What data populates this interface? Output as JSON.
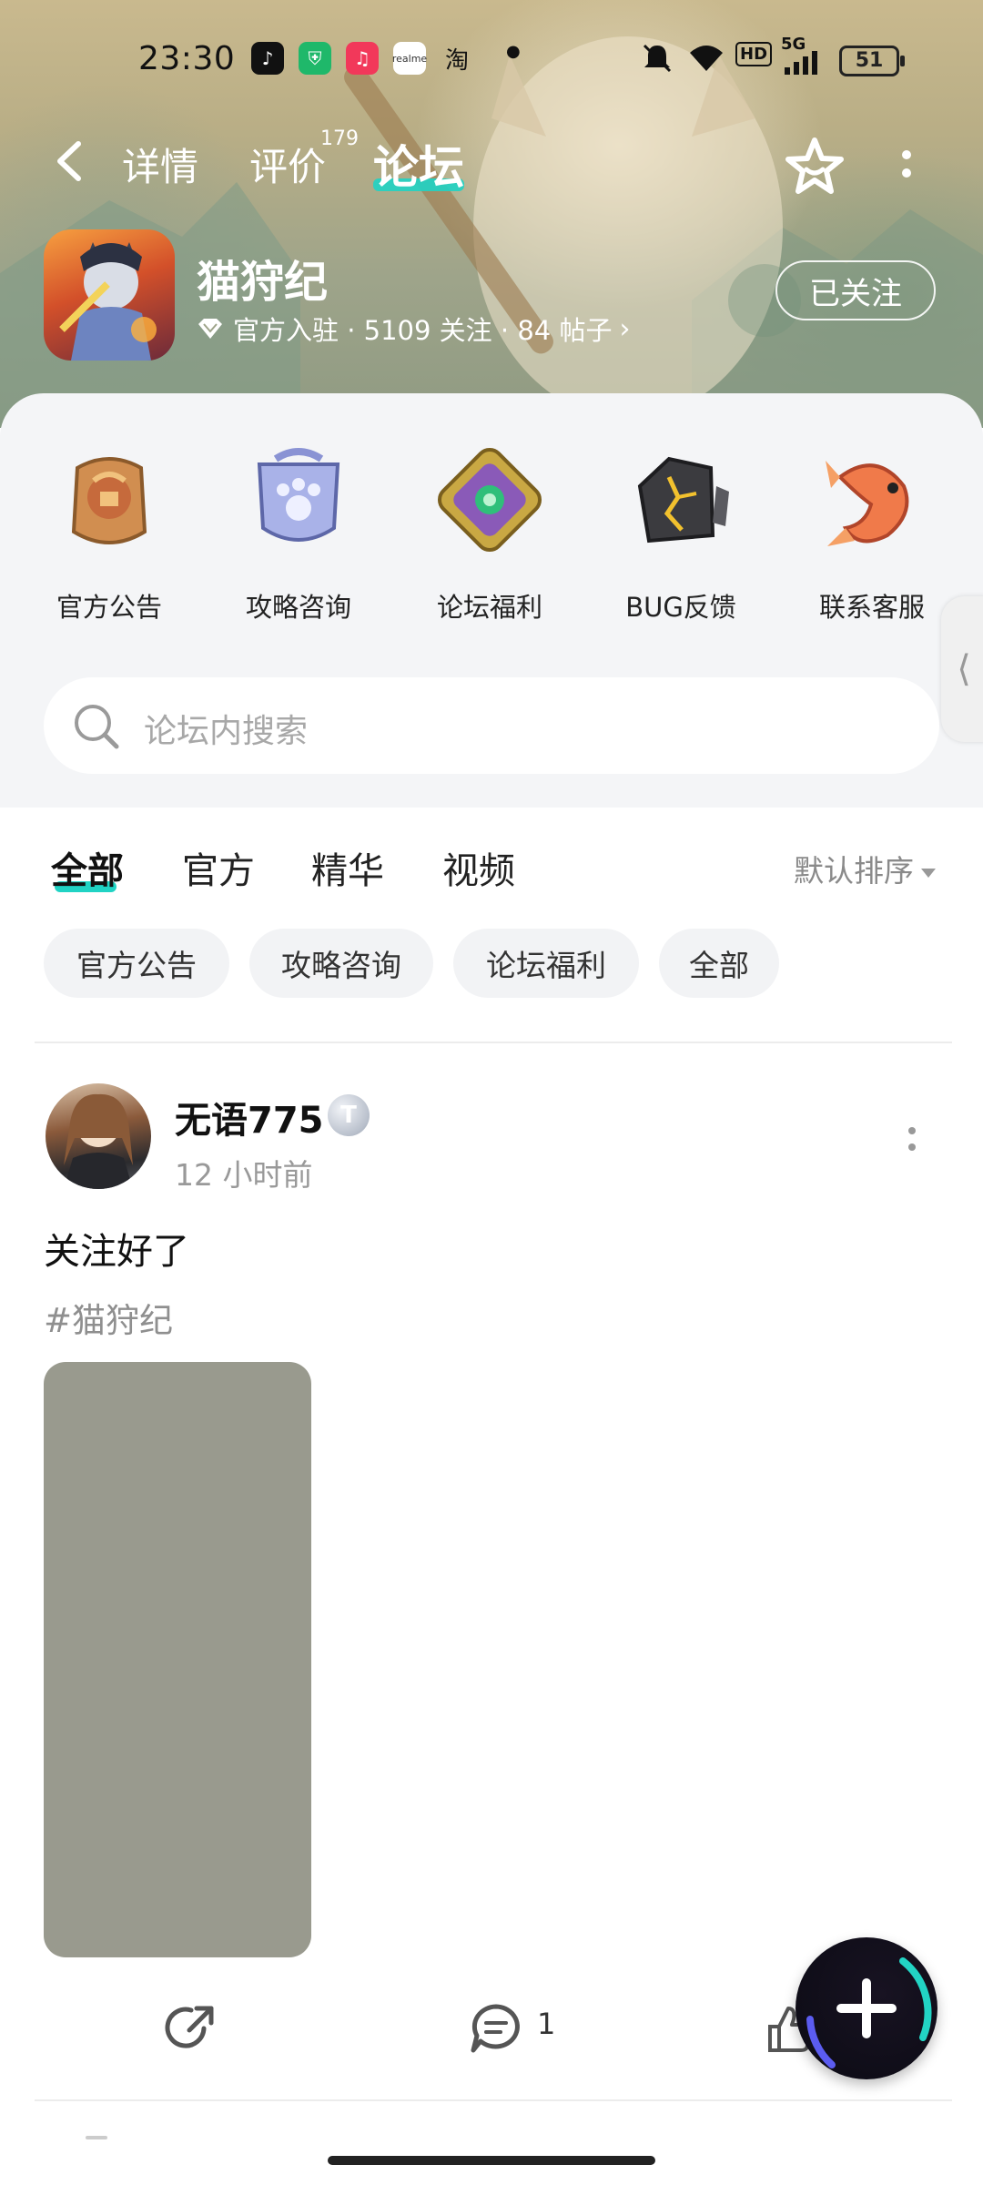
{
  "status_bar": {
    "time": "23:30",
    "apps": [
      "tiktok-icon",
      "shield-icon",
      "music-icon",
      "realme-icon",
      "taobao-icon"
    ],
    "taobao_label": "淘",
    "realme_label": "realme",
    "network": "5G",
    "hd": "HD",
    "battery": "51"
  },
  "nav": {
    "tabs": [
      {
        "label": "详情"
      },
      {
        "label": "评价"
      },
      {
        "label": "论坛"
      }
    ],
    "review_count": "179",
    "active_tab": "论坛"
  },
  "game": {
    "title": "猫狩纪",
    "meta": "官方入驻 · 5109 关注 · 84 帖子",
    "follow_label": "已关注"
  },
  "categories": [
    {
      "label": "官方公告"
    },
    {
      "label": "攻略咨询"
    },
    {
      "label": "论坛福利"
    },
    {
      "label": "BUG反馈"
    },
    {
      "label": "联系客服"
    }
  ],
  "search": {
    "placeholder": "论坛内搜索"
  },
  "feed_tabs": [
    {
      "label": "全部"
    },
    {
      "label": "官方"
    },
    {
      "label": "精华"
    },
    {
      "label": "视频"
    }
  ],
  "sort_label": "默认排序",
  "chips": [
    {
      "label": "官方公告"
    },
    {
      "label": "攻略咨询"
    },
    {
      "label": "论坛福利"
    },
    {
      "label": "全部"
    }
  ],
  "post": {
    "username": "无语775",
    "badge": "T",
    "time": "12 小时前",
    "text": "关注好了",
    "tag": "#猫狩纪",
    "comment_count": "1"
  },
  "colors": {
    "accent": "#20d3c4",
    "chip_bg": "#f2f3f5",
    "sheet_bg": "#f4f5f7"
  }
}
